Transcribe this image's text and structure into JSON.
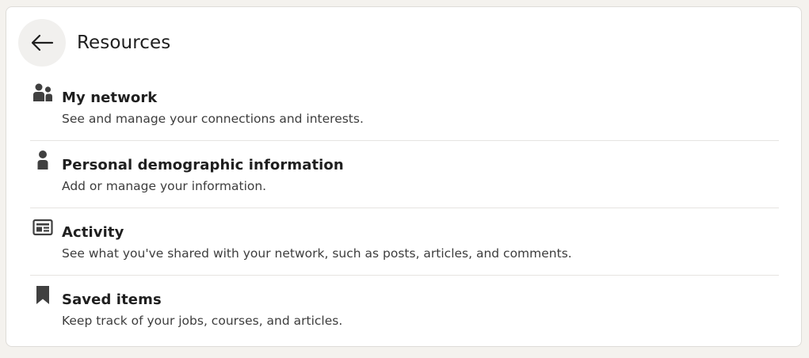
{
  "header": {
    "title": "Resources"
  },
  "items": [
    {
      "icon": "people-icon",
      "label": "My network",
      "description": "See and manage your connections and interests."
    },
    {
      "icon": "person-icon",
      "label": "Personal demographic information",
      "description": "Add or manage your information."
    },
    {
      "icon": "activity-icon",
      "label": "Activity",
      "description": "See what you've shared with your network, such as posts, articles, and comments."
    },
    {
      "icon": "bookmark-icon",
      "label": "Saved items",
      "description": "Keep track of your jobs, courses, and articles."
    }
  ],
  "colors": {
    "background": "#f4f2ee",
    "card": "#ffffff",
    "text": "#1f1f1f",
    "icon": "#404040"
  }
}
